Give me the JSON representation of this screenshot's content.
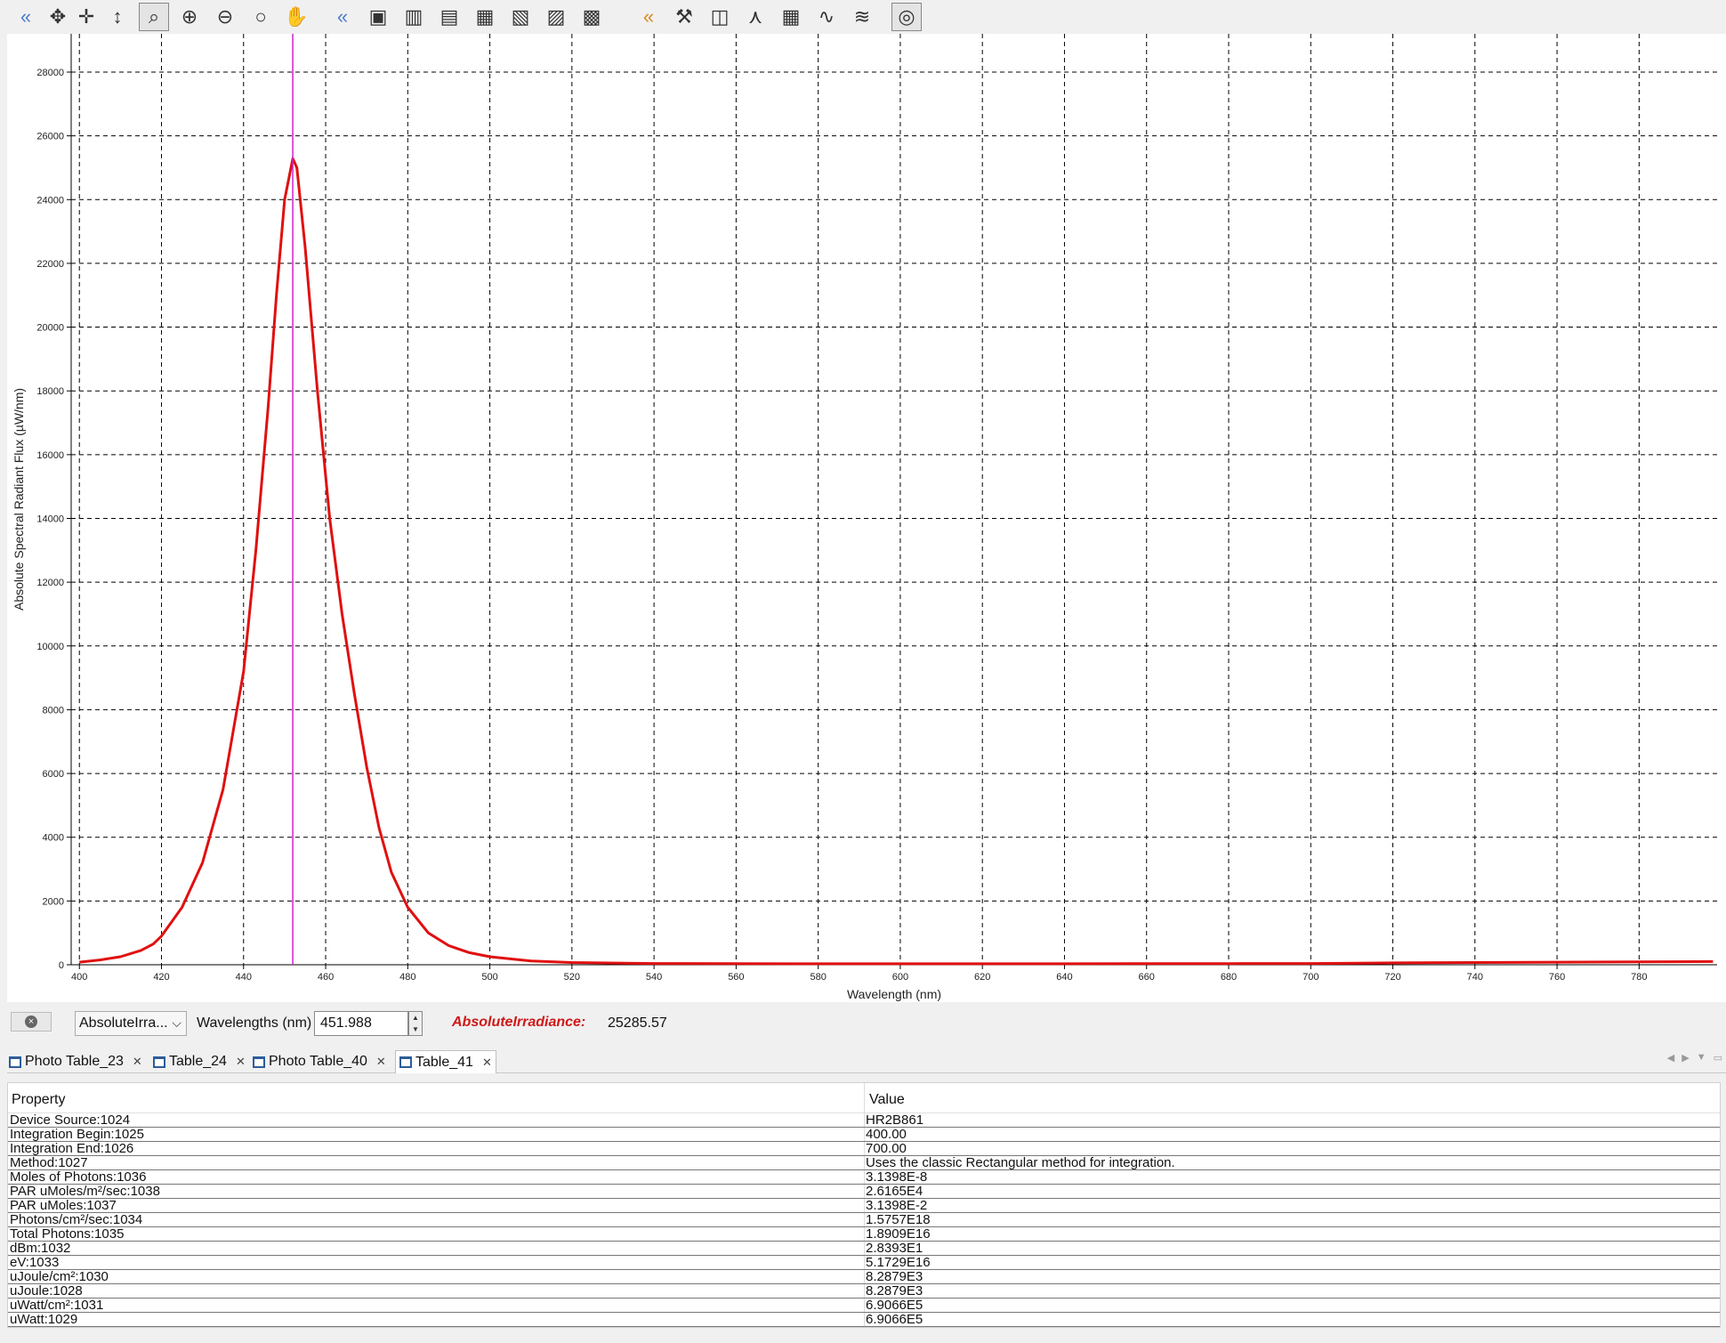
{
  "toolbar": {
    "items": [
      {
        "name": "collapse-left-icon",
        "glyph": "«"
      },
      {
        "name": "move-all-icon",
        "glyph": "✥"
      },
      {
        "name": "crosshair-icon",
        "glyph": "✛"
      },
      {
        "name": "vertical-move-icon",
        "glyph": "↕"
      },
      {
        "name": "zoom-box-icon",
        "glyph": "⌕"
      },
      {
        "name": "zoom-in-icon",
        "glyph": "⊕"
      },
      {
        "name": "zoom-out-icon",
        "glyph": "⊖"
      },
      {
        "name": "zoom-reset-icon",
        "glyph": "○"
      },
      {
        "name": "pan-hand-icon",
        "glyph": "✋"
      },
      {
        "name": "collapse-left-2-icon",
        "glyph": "«"
      },
      {
        "name": "camera-icon",
        "glyph": "▣"
      },
      {
        "name": "trash-icon",
        "glyph": "▥"
      },
      {
        "name": "copy-icon",
        "glyph": "▤"
      },
      {
        "name": "save-icon",
        "glyph": "▦"
      },
      {
        "name": "save-all-icon",
        "glyph": "▧"
      },
      {
        "name": "export-icon",
        "glyph": "▨"
      },
      {
        "name": "print-icon",
        "glyph": "▩"
      },
      {
        "name": "collapse-right-icon",
        "glyph": "«"
      },
      {
        "name": "tools-icon",
        "glyph": "⚒"
      },
      {
        "name": "chart-area-icon",
        "glyph": "◫"
      },
      {
        "name": "peak-icon",
        "glyph": "⋏"
      },
      {
        "name": "table-icon",
        "glyph": "▦"
      },
      {
        "name": "spectrum-icon",
        "glyph": "∿"
      },
      {
        "name": "pattern-icon",
        "glyph": "≋"
      },
      {
        "name": "lightbulb-icon",
        "glyph": "◎"
      }
    ]
  },
  "chart_data": {
    "type": "line",
    "xlabel": "Wavelength (nm)",
    "ylabel": "Absolute Spectral Radiant Flux (µW/nm)",
    "xlim": [
      398,
      799
    ],
    "ylim": [
      0,
      29200
    ],
    "x_ticks": [
      400,
      420,
      440,
      460,
      480,
      500,
      520,
      540,
      560,
      580,
      600,
      620,
      640,
      660,
      680,
      700,
      720,
      740,
      760,
      780
    ],
    "y_ticks": [
      0,
      2000,
      4000,
      6000,
      8000,
      10000,
      12000,
      14000,
      16000,
      18000,
      20000,
      22000,
      24000,
      26000,
      28000
    ],
    "grid": true,
    "cursor_x": 451.988,
    "series": [
      {
        "color": "#e01010",
        "points": [
          [
            400,
            80
          ],
          [
            405,
            150
          ],
          [
            410,
            250
          ],
          [
            415,
            450
          ],
          [
            418,
            650
          ],
          [
            420,
            900
          ],
          [
            425,
            1800
          ],
          [
            430,
            3200
          ],
          [
            435,
            5500
          ],
          [
            440,
            9200
          ],
          [
            443,
            13000
          ],
          [
            446,
            17500
          ],
          [
            448,
            21000
          ],
          [
            450,
            24000
          ],
          [
            452,
            25285
          ],
          [
            453,
            25000
          ],
          [
            455,
            22500
          ],
          [
            458,
            18000
          ],
          [
            461,
            14000
          ],
          [
            464,
            11000
          ],
          [
            467,
            8500
          ],
          [
            470,
            6200
          ],
          [
            473,
            4300
          ],
          [
            476,
            2900
          ],
          [
            480,
            1800
          ],
          [
            485,
            1000
          ],
          [
            490,
            600
          ],
          [
            495,
            380
          ],
          [
            500,
            250
          ],
          [
            510,
            120
          ],
          [
            520,
            70
          ],
          [
            540,
            40
          ],
          [
            560,
            35
          ],
          [
            580,
            30
          ],
          [
            600,
            30
          ],
          [
            620,
            30
          ],
          [
            640,
            30
          ],
          [
            660,
            35
          ],
          [
            680,
            35
          ],
          [
            700,
            40
          ],
          [
            720,
            60
          ],
          [
            740,
            70
          ],
          [
            760,
            80
          ],
          [
            780,
            90
          ],
          [
            798,
            100
          ]
        ]
      }
    ]
  },
  "cursor_bar": {
    "series_select": "AbsoluteIrra...",
    "wavelength_label": "Wavelengths (nm)",
    "wavelength_value": "451.988",
    "readout_label": "AbsoluteIrradiance:",
    "readout_value": "25285.57"
  },
  "tabs": [
    {
      "label": "Photo Table_23",
      "selected": false
    },
    {
      "label": "Table_24",
      "selected": false
    },
    {
      "label": "Photo Table_40",
      "selected": false
    },
    {
      "label": "Table_41",
      "selected": true
    }
  ],
  "table": {
    "headers": [
      "Property",
      "Value"
    ],
    "rows": [
      [
        "Device Source:1024",
        "HR2B861"
      ],
      [
        "Integration Begin:1025",
        "400.00"
      ],
      [
        "Integration End:1026",
        "700.00"
      ],
      [
        "Method:1027",
        "Uses the classic Rectangular method for integration."
      ],
      [
        "Moles of Photons:1036",
        "3.1398E-8"
      ],
      [
        "PAR uMoles/m²/sec:1038",
        "2.6165E4"
      ],
      [
        "PAR uMoles:1037",
        "3.1398E-2"
      ],
      [
        "Photons/cm²/sec:1034",
        "1.5757E18"
      ],
      [
        "Total Photons:1035",
        "1.8909E16"
      ],
      [
        "dBm:1032",
        "2.8393E1"
      ],
      [
        "eV:1033",
        "5.1729E16"
      ],
      [
        "uJoule/cm²:1030",
        "8.2879E3"
      ],
      [
        "uJoule:1028",
        "8.2879E3"
      ],
      [
        "uWatt/cm²:1031",
        "6.9066E5"
      ],
      [
        "uWatt:1029",
        "6.9066E5"
      ]
    ]
  }
}
